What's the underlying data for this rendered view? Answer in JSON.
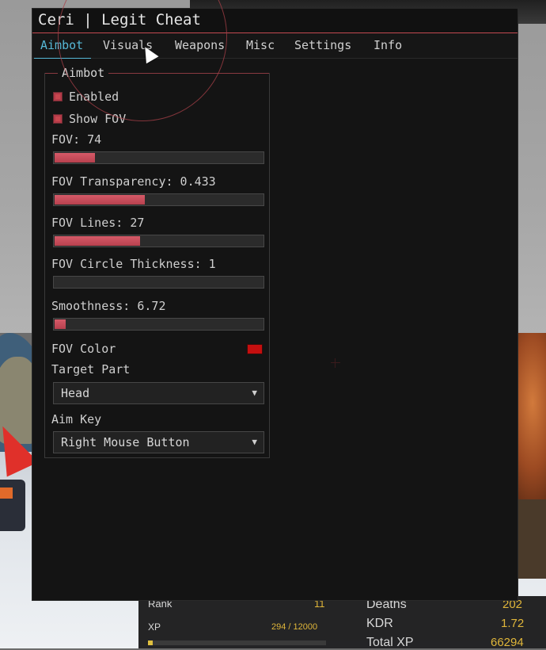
{
  "window": {
    "title": "Ceri | Legit Cheat"
  },
  "tabs": [
    "Aimbot",
    "Visuals",
    "Weapons",
    "Misc",
    "Settings",
    "Info"
  ],
  "active_tab": "Aimbot",
  "aimbot": {
    "group_title": "Aimbot",
    "enabled": {
      "label": "Enabled",
      "checked": true
    },
    "show_fov": {
      "label": "Show FOV",
      "checked": true
    },
    "fov": {
      "label": "FOV: 74",
      "fill": 0.195
    },
    "fov_transparency": {
      "label": "FOV Transparency: 0.433",
      "fill": 0.433
    },
    "fov_lines": {
      "label": "FOV Lines: 27",
      "fill": 0.41
    },
    "fov_circle_thickness": {
      "label": "FOV Circle Thickness: 1",
      "fill": 0.0
    },
    "smoothness": {
      "label": "Smoothness: 6.72",
      "fill": 0.055
    },
    "fov_color": {
      "label": "FOV Color",
      "color": "#c40f0f"
    },
    "target_part": {
      "label": "Target Part",
      "value": "Head"
    },
    "aim_key": {
      "label": "Aim Key",
      "value": "Right Mouse Button"
    }
  },
  "hud": {
    "rank_label": "Rank",
    "rank_value": "11",
    "deaths_label": "Deaths",
    "deaths_value": "202",
    "xp_label": "XP",
    "xp_value": "294 / 12000",
    "xp_progress": 0.0245,
    "kdr_label": "KDR",
    "kdr_value": "1.72",
    "total_xp_label": "Total XP",
    "total_xp_value": "66294"
  },
  "colors": {
    "accent": "#c44a52",
    "active_tab": "#56b8d6",
    "slider_fill": "#c84a5a",
    "hud_value": "#e0b63a"
  }
}
